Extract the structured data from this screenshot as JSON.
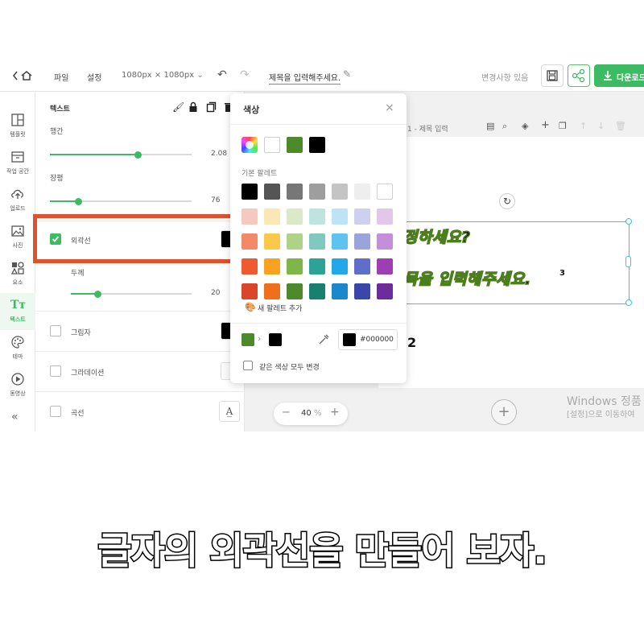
{
  "topbar": {
    "file_menu": "파일",
    "settings_menu": "설정",
    "size_label": "1080px × 1080px",
    "title_placeholder": "제목을 입력해주세요.",
    "status": "변경사항 있음",
    "download_label": "다운로드"
  },
  "leftnav": {
    "items": [
      {
        "label": "템플릿",
        "icon": "template-icon"
      },
      {
        "label": "작업 공간",
        "icon": "workspace-icon"
      },
      {
        "label": "업로드",
        "icon": "upload-icon"
      },
      {
        "label": "사진",
        "icon": "photo-icon"
      },
      {
        "label": "요소",
        "icon": "elements-icon"
      },
      {
        "label": "텍스트",
        "icon": "text-icon"
      },
      {
        "label": "테마",
        "icon": "theme-icon"
      },
      {
        "label": "동영상",
        "icon": "video-icon"
      }
    ],
    "collapse": "«"
  },
  "textpanel": {
    "title": "텍스트",
    "line_height_label": "행간",
    "line_height_value": "2.08",
    "line_height_fraction": 0.62,
    "width_label": "장평",
    "width_value": "76",
    "width_fraction": 0.2,
    "outline_label": "외곽선",
    "outline_checked": true,
    "thickness_label": "두께",
    "thickness_value": "20",
    "thickness_fraction": 0.22,
    "shadow_label": "그림자",
    "gradient_label": "그라데이션",
    "curve_label": "곡선"
  },
  "colorpopup": {
    "title": "색상",
    "basic_palette_label": "기본 팔레트",
    "recent_colors": [
      "#4e8a2b",
      "#000000"
    ],
    "palette": [
      [
        "#000000",
        "#555555",
        "#777777",
        "#9e9e9e",
        "#c4c4c4",
        "#eeeeee",
        "#ffffff"
      ],
      [
        "#f6c8bf",
        "#fbe7b5",
        "#dce8c8",
        "#bfe4df",
        "#bde3f6",
        "#cdd0ee",
        "#e1c8ea"
      ],
      [
        "#f28a6a",
        "#fbc94a",
        "#aed28a",
        "#7fc9bf",
        "#5ec3ef",
        "#9aa4da",
        "#c48fd8"
      ],
      [
        "#ef5a32",
        "#f8a21f",
        "#7fb64a",
        "#2ba396",
        "#22a7e9",
        "#5e6ec9",
        "#9b3fb3"
      ],
      [
        "#d9462a",
        "#f06f1a",
        "#4e8a2b",
        "#17806f",
        "#1b88cb",
        "#3847a8",
        "#6e2b9a"
      ]
    ],
    "add_palette_label": "새 팔레트 추가",
    "from_color": "#4e8a2b",
    "to_color": "#000000",
    "hex_value": "#000000",
    "same_color_label": "같은 색상 모두 변경"
  },
  "canvas": {
    "page_header": "1 - 제목 입력",
    "text_line1": "정하세요?",
    "text_line2": "목을 입력해주세요.",
    "superscript": "3",
    "page_number": "2",
    "windows_line1": "Windows 정품",
    "windows_line2": "[설정]으로 이동하여"
  },
  "zoom": {
    "value": "40",
    "unit": "%"
  },
  "caption": "글자의 외곽선을 만들어 보자.",
  "highlight_color": "#e0512c"
}
